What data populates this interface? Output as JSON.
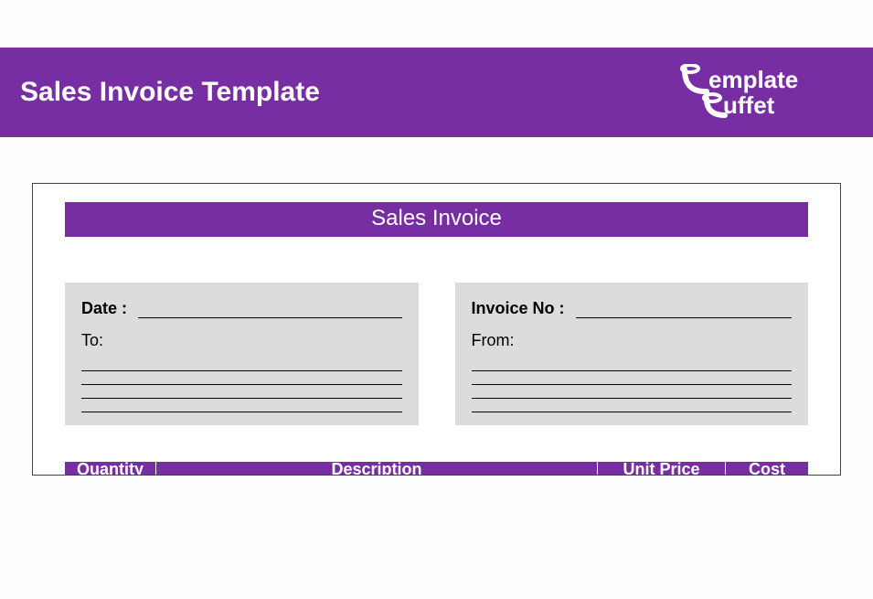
{
  "header": {
    "title": "Sales Invoice Template",
    "logo_text_top": "emplate",
    "logo_text_bottom": "uffet"
  },
  "document": {
    "title": "Sales Invoice",
    "left_box": {
      "date_label": "Date :",
      "to_label": "To:"
    },
    "right_box": {
      "invoice_no_label": "Invoice No :",
      "from_label": "From:"
    },
    "table": {
      "columns": {
        "quantity": "Quantity",
        "description": "Description",
        "unit_price": "Unit Price",
        "cost": "Cost"
      }
    }
  }
}
